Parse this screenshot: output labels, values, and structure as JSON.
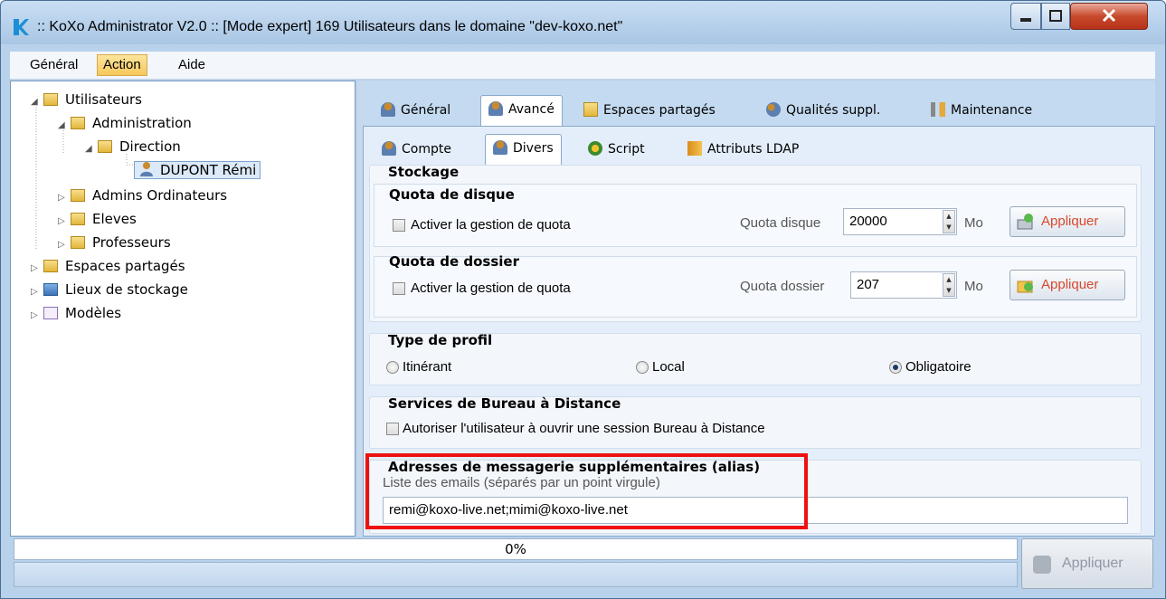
{
  "window": {
    "title": ":: KoXo Administrator V2.0 :: [Mode expert] 169 Utilisateurs dans le domaine \"dev-koxo.net\""
  },
  "menu": {
    "general": "Général",
    "action": "Action",
    "aide": "Aide"
  },
  "tree": {
    "items": [
      {
        "label": "Utilisateurs",
        "icon": "folder-icon"
      },
      {
        "label": "Administration",
        "icon": "folder-icon"
      },
      {
        "label": "Direction",
        "icon": "folder-icon"
      },
      {
        "label": "DUPONT Rémi",
        "icon": "user-icon"
      },
      {
        "label": "Admins Ordinateurs",
        "icon": "folder-icon"
      },
      {
        "label": "Eleves",
        "icon": "folder-icon"
      },
      {
        "label": "Professeurs",
        "icon": "folder-icon"
      },
      {
        "label": "Espaces partagés",
        "icon": "shared-space-icon"
      },
      {
        "label": "Lieux de stockage",
        "icon": "storage-icon"
      },
      {
        "label": "Modèles",
        "icon": "template-icon"
      }
    ]
  },
  "tabs": {
    "top": [
      "Général",
      "Avancé",
      "Espaces partagés",
      "Qualités suppl.",
      "Maintenance"
    ],
    "sub": [
      "Compte",
      "Divers",
      "Script",
      "Attributs LDAP"
    ]
  },
  "stockage": {
    "title": "Stockage",
    "disque": {
      "title": "Quota de disque",
      "checkbox_label": "Activer la gestion de quota",
      "field_label": "Quota disque",
      "value": "20000",
      "unit": "Mo",
      "apply_label": "Appliquer"
    },
    "dossier": {
      "title": "Quota de dossier",
      "checkbox_label": "Activer la gestion de quota",
      "field_label": "Quota dossier",
      "value": "207",
      "unit": "Mo",
      "apply_label": "Appliquer"
    }
  },
  "profil": {
    "title": "Type de profil",
    "options": [
      "Itinérant",
      "Local",
      "Obligatoire"
    ],
    "selected": "Obligatoire"
  },
  "bureau": {
    "title": "Services de Bureau à Distance",
    "checkbox_label": "Autoriser l'utilisateur à ouvrir une session Bureau à Distance"
  },
  "alias": {
    "title": "Adresses de messagerie supplémentaires (alias)",
    "hint": "Liste des emails (séparés par un point virgule)",
    "value": "remi@koxo-live.net;mimi@koxo-live.net"
  },
  "progress": {
    "text": "0%",
    "value": 0
  },
  "footer": {
    "apply_label": "Appliquer"
  },
  "colors": {
    "highlight": "#ee1111",
    "apply_text": "#d8472d",
    "menu_active": "#f6c85a"
  }
}
